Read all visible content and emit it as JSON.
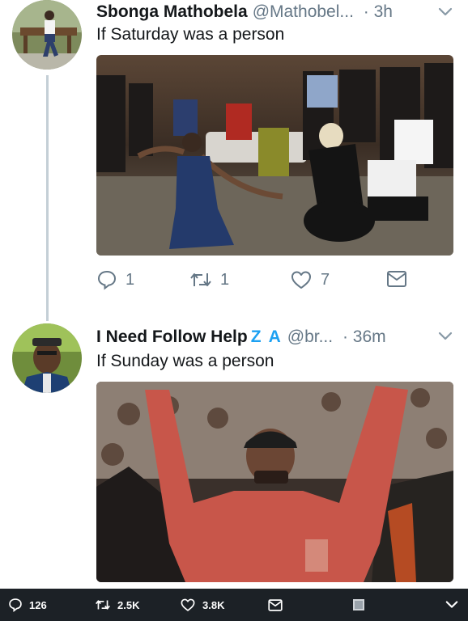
{
  "tweet1": {
    "name": "Sbonga Mathobela",
    "handle": "@Mathobel...",
    "time": "· 3h",
    "text": "If Saturday was a person",
    "replies": "1",
    "retweets": "1",
    "likes": "7"
  },
  "tweet2": {
    "name": "I Need Follow Help",
    "name_badge": "Z A",
    "handle": "@br...",
    "time": "· 36m",
    "text": "If Sunday was a person"
  },
  "bottom_bar": {
    "replies": "126",
    "retweets": "2.5K",
    "likes": "3.8K"
  },
  "colors": {
    "text": "#14171a",
    "secondary": "#657786",
    "accent": "#1da1f2",
    "thread_line": "#c4cfd6",
    "bottom_bar": "#1c2126"
  },
  "icons": [
    "reply-icon",
    "retweet-icon",
    "like-icon",
    "share-icon",
    "chevron-down-icon"
  ]
}
